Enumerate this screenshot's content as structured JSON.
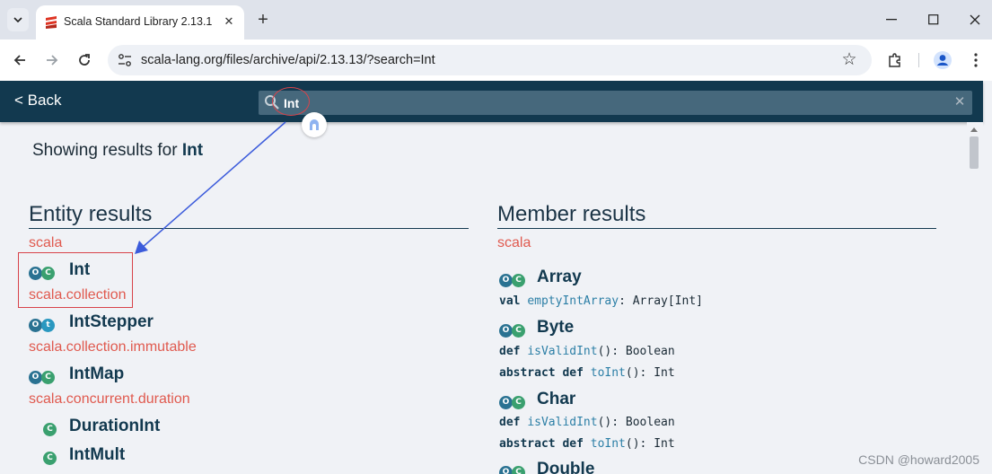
{
  "browser": {
    "tab_title": "Scala Standard Library 2.13.1",
    "tab_close": "✕",
    "new_tab": "+",
    "url": "scala-lang.org/files/archive/api/2.13.13/?search=Int",
    "window_controls": {
      "minimize": "—",
      "maximize": "☐",
      "close": "✕"
    }
  },
  "page": {
    "back_label": "< Back",
    "search_value": "Int",
    "clear_label": "✕",
    "results_prefix": "Showing results for",
    "results_query": "Int",
    "entity": {
      "title": "Entity results",
      "groups": [
        {
          "package": "scala",
          "items": [
            {
              "name": "Int",
              "badges": [
                "O",
                "C"
              ]
            }
          ]
        },
        {
          "package": "scala.collection",
          "items": [
            {
              "name": "IntStepper",
              "badges": [
                "O",
                "t"
              ]
            }
          ]
        },
        {
          "package": "scala.collection.immutable",
          "items": [
            {
              "name": "IntMap",
              "badges": [
                "O",
                "C"
              ]
            }
          ]
        },
        {
          "package": "scala.concurrent.duration",
          "items": [
            {
              "name": "DurationInt",
              "badges": [
                "C"
              ]
            },
            {
              "name": "IntMult",
              "badges": [
                "C"
              ]
            }
          ]
        }
      ]
    },
    "member": {
      "title": "Member results",
      "package": "scala",
      "entries": [
        {
          "name": "Array",
          "badges": [
            "O",
            "C"
          ],
          "members": [
            {
              "kw": "val",
              "name": "emptyIntArray",
              "sig": ": Array[Int]"
            }
          ]
        },
        {
          "name": "Byte",
          "badges": [
            "O",
            "C"
          ],
          "members": [
            {
              "kw": "def",
              "name": "isValidInt",
              "sig": "(): Boolean"
            },
            {
              "kw": "abstract def",
              "name": "toInt",
              "sig": "(): Int"
            }
          ]
        },
        {
          "name": "Char",
          "badges": [
            "O",
            "C"
          ],
          "members": [
            {
              "kw": "def",
              "name": "isValidInt",
              "sig": "(): Boolean"
            },
            {
              "kw": "abstract def",
              "name": "toInt",
              "sig": "(): Int"
            }
          ]
        },
        {
          "name": "Double",
          "badges": [
            "O",
            "C"
          ],
          "members": []
        }
      ]
    }
  },
  "watermark": "CSDN @howard2005",
  "colors": {
    "header": "#12394f",
    "package": "#e05a4f",
    "object_badge": "#2a7292",
    "class_badge": "#3aa06f",
    "annotation": "#d8434a",
    "arrow": "#3b5bdb"
  }
}
